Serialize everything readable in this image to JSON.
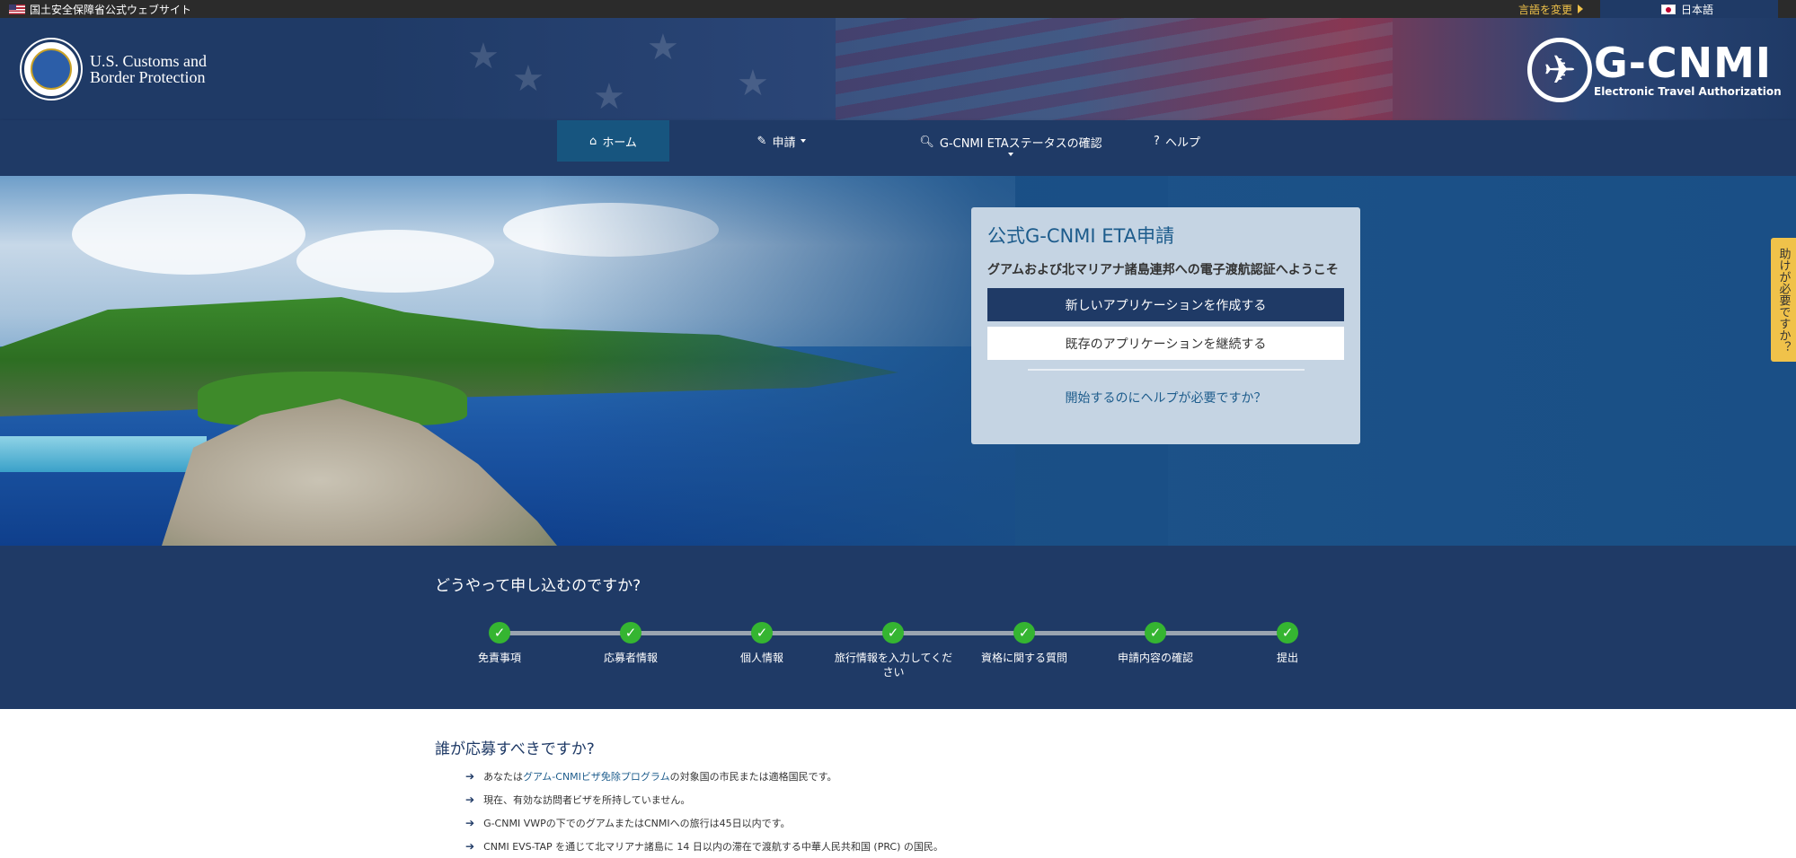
{
  "govbar": {
    "official_text": "国土安全保障省公式ウェブサイト",
    "change_language": "言語を変更",
    "current_language": "日本語"
  },
  "header": {
    "cbp_line1": "U.S. Customs and",
    "cbp_line2": "Border Protection",
    "gcnmi_title": "G-CNMI",
    "gcnmi_subtitle": "Electronic Travel Authorization"
  },
  "nav": {
    "items": [
      {
        "label": "ホーム",
        "icon": "home-icon"
      },
      {
        "label": "申請",
        "icon": "pencil-icon"
      },
      {
        "label": "G-CNMI ETAステータスの確認",
        "icon": "search-icon"
      },
      {
        "label": "ヘルプ",
        "icon": "question-circle-icon"
      }
    ]
  },
  "apply_card": {
    "title": "公式G-CNMI ETA申請",
    "welcome": "グアムおよび北マリアナ諸島連邦への電子渡航認証へようこそ",
    "new_button": "新しいアプリケーションを作成する",
    "continue_button": "既存のアプリケーションを継続する",
    "help_link": "開始するのにヘルプが必要ですか？"
  },
  "side_help": "助けが必要ですか？",
  "steps": {
    "title": "どうやって申し込むのですか?",
    "items": [
      "免責事項",
      "応募者情報",
      "個人情報",
      "旅行情報を入力してください",
      "資格に関する質問",
      "申請内容の確認",
      "提出"
    ]
  },
  "who": {
    "title": "誰が応募すべきですか?",
    "item1_prefix": "あなたは",
    "item1_link": "グアム-CNMIビザ免除プログラム",
    "item1_suffix": "の対象国の市民または適格国民です。",
    "item2": "現在、有効な訪問者ビザを所持していません。",
    "item3": "G-CNMI VWPの下でのグアムまたはCNMIへの旅行は45日以内です。",
    "item4": "CNMI EVS-TAP を通じて北マリアナ諸島に 14 日以内の滞在で渡航する中華人民共和国 (PRC) の国民。"
  }
}
